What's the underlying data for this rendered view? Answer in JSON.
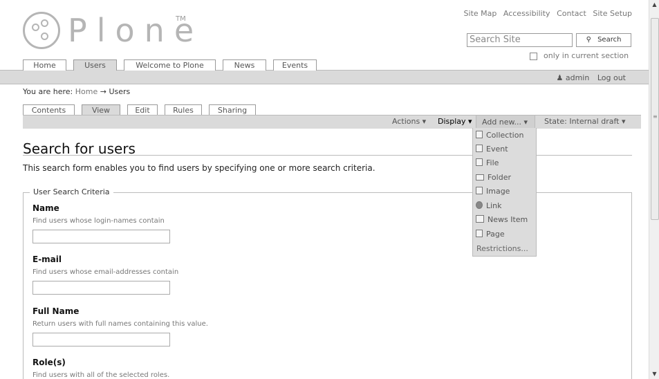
{
  "logo": {
    "text": "Plone",
    "tm": "TM"
  },
  "site_actions": [
    "Site Map",
    "Accessibility",
    "Contact",
    "Site Setup"
  ],
  "search": {
    "placeholder": "Search Site",
    "button": "Search",
    "current_section_label": "only in current section",
    "current_section_checked": false
  },
  "portal_tabs": [
    {
      "label": "Home"
    },
    {
      "label": "Users",
      "selected": true
    },
    {
      "label": "Welcome to Plone"
    },
    {
      "label": "News"
    },
    {
      "label": "Events"
    }
  ],
  "user": {
    "name": "admin",
    "logout": "Log out"
  },
  "breadcrumbs": {
    "prefix": "You are here:",
    "home": "Home",
    "arrow": "→",
    "current": "Users"
  },
  "content_tabs": [
    {
      "label": "Contents"
    },
    {
      "label": "View",
      "selected": true
    },
    {
      "label": "Edit"
    },
    {
      "label": "Rules"
    },
    {
      "label": "Sharing"
    }
  ],
  "content_actions": {
    "actions": "Actions ▾",
    "display": "Display ▾",
    "add_new": "Add new... ▾",
    "state": "State: Internal draft ▾"
  },
  "add_new_menu": {
    "items": [
      "Collection",
      "Event",
      "File",
      "Folder",
      "Image",
      "Link",
      "News Item",
      "Page"
    ],
    "restrictions": "Restrictions..."
  },
  "page": {
    "title": "Search for users",
    "description": "This search form enables you to find users by specifying one or more search criteria."
  },
  "criteria": {
    "legend": "User Search Criteria",
    "fields": [
      {
        "label": "Name",
        "help": "Find users whose login-names contain",
        "value": ""
      },
      {
        "label": "E-mail",
        "help": "Find users whose email-addresses contain",
        "value": ""
      },
      {
        "label": "Full Name",
        "help": "Return users with full names containing this value.",
        "value": ""
      },
      {
        "label": "Role(s)",
        "help": "Find users with all of the selected roles."
      }
    ]
  },
  "colors": {
    "bar": "#dadada",
    "border": "#999999",
    "logo": "#b5b5b5"
  }
}
